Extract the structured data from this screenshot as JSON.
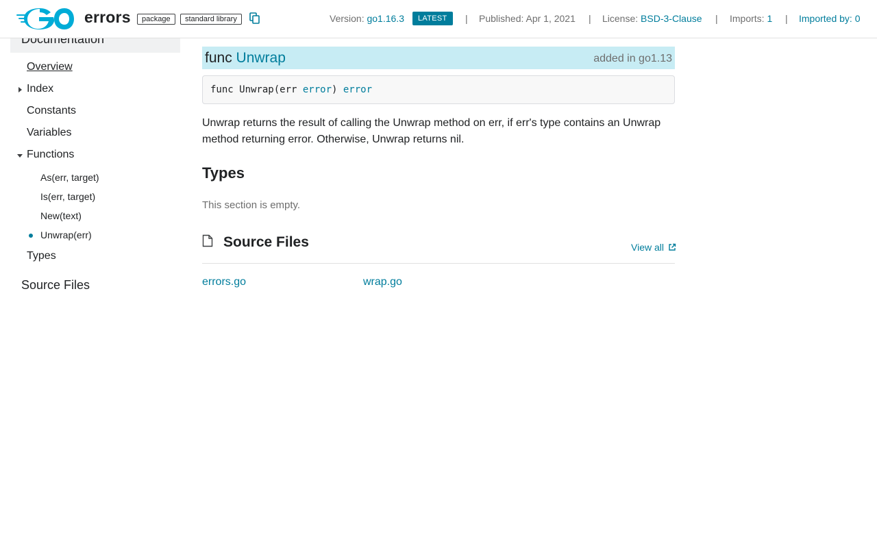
{
  "header": {
    "package_name": "errors",
    "chips": [
      "package",
      "standard library"
    ],
    "version_label": "Version:",
    "version_value": "go1.16.3",
    "latest_badge": "LATEST",
    "separator": "|",
    "published": "Published: Apr 1, 2021",
    "license_label": "License:",
    "license_value": "BSD-3-Clause",
    "imports_label": "Imports:",
    "imports_value": "1",
    "imported_by": "Imported by: 0"
  },
  "sidebar": {
    "documentation": "Documentation",
    "items": {
      "overview": "Overview",
      "index": "Index",
      "constants": "Constants",
      "variables": "Variables",
      "functions": "Functions",
      "types": "Types"
    },
    "function_items": [
      "As(err, target)",
      "Is(err, target)",
      "New(text)",
      "Unwrap(err)"
    ],
    "source_files": "Source Files"
  },
  "main": {
    "func_keyword": "func",
    "func_name": "Unwrap",
    "added_in": "added in go1.13",
    "code": {
      "prefix": "func Unwrap(err ",
      "param_type": "error",
      "mid": ") ",
      "return_type": "error"
    },
    "description": "Unwrap returns the result of calling the Unwrap method on err, if err's type contains an Unwrap method returning error. Otherwise, Unwrap returns nil.",
    "types_heading": "Types",
    "types_empty": "This section is empty.",
    "source_files_heading": "Source Files",
    "view_all": "View all",
    "files": [
      "errors.go",
      "wrap.go"
    ]
  },
  "colors": {
    "accent": "#007d9c",
    "func_bar": "#c7ecf4",
    "sidebar_highlight": "#f0f1f2"
  },
  "icons": [
    "go-logo-icon",
    "copy-icon",
    "chevron-right-icon",
    "chevron-down-icon",
    "file-icon",
    "external-link-icon"
  ]
}
